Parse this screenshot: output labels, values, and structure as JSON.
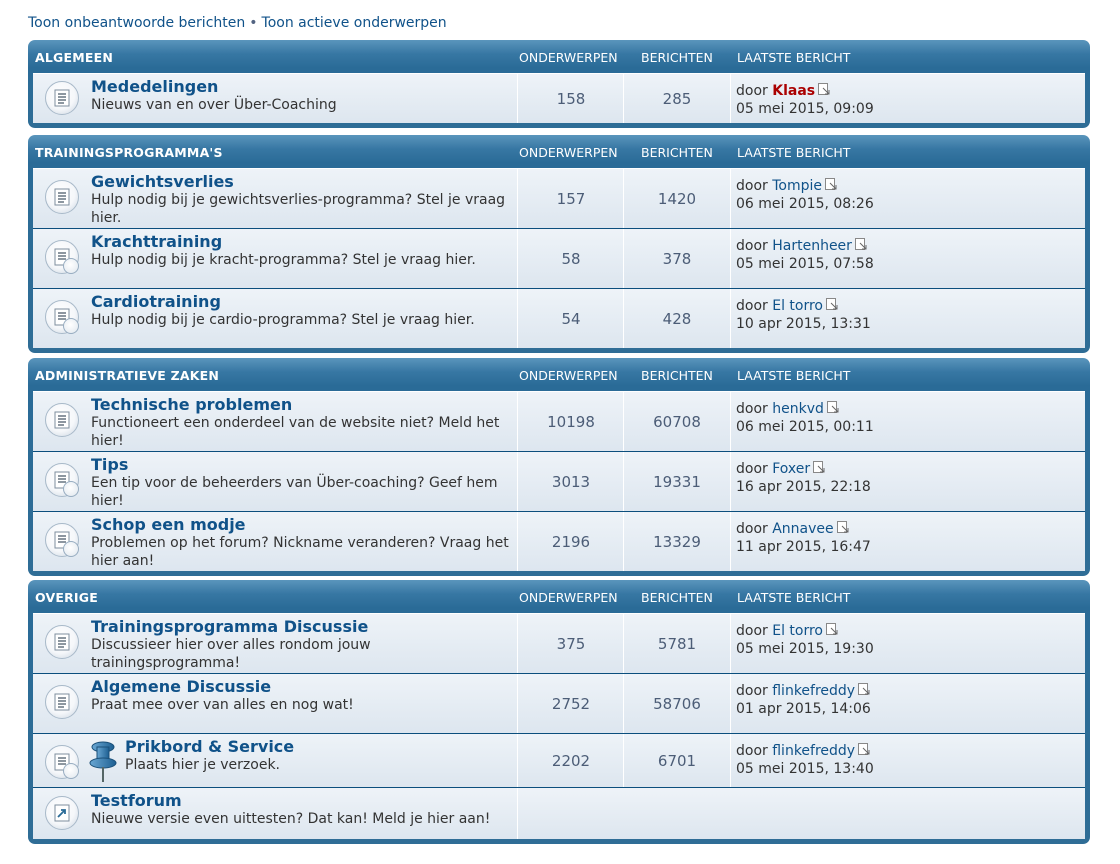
{
  "top_links": {
    "unanswered": "Toon onbeantwoorde berichten",
    "separator": "•",
    "active": "Toon actieve onderwerpen"
  },
  "col_headers": {
    "topics": "ONDERWERPEN",
    "posts": "BERICHTEN",
    "last_post": "LAATSTE BERICHT"
  },
  "by_label": "door",
  "categories": [
    {
      "title": "ALGEMEEN",
      "forums": [
        {
          "title": "Mededelingen",
          "desc": "Nieuws van en over Über-Coaching",
          "topics": "158",
          "posts": "285",
          "author": "Klaas",
          "author_color": "#aa0000",
          "date": "05 mei 2015, 09:09",
          "icon": "forum-read-icon"
        }
      ]
    },
    {
      "title": "TRAININGSPROGRAMMA'S",
      "forums": [
        {
          "title": "Gewichtsverlies",
          "desc": "Hulp nodig bij je gewichtsverlies-programma? Stel je vraag hier.",
          "topics": "157",
          "posts": "1420",
          "author": "Tompie",
          "date": "06 mei 2015, 08:26",
          "icon": "forum-read-icon"
        },
        {
          "title": "Krachttraining",
          "desc": "Hulp nodig bij je kracht-programma? Stel je vraag hier.",
          "topics": "58",
          "posts": "378",
          "author": "Hartenheer",
          "date": "05 mei 2015, 07:58",
          "icon": "forum-subforum-icon"
        },
        {
          "title": "Cardiotraining",
          "desc": "Hulp nodig bij je cardio-programma? Stel je vraag hier.",
          "topics": "54",
          "posts": "428",
          "author": "El torro",
          "date": "10 apr 2015, 13:31",
          "icon": "forum-subforum-icon"
        }
      ]
    },
    {
      "title": "ADMINISTRATIEVE ZAKEN",
      "forums": [
        {
          "title": "Technische problemen",
          "desc": "Functioneert een onderdeel van de website niet? Meld het hier!",
          "topics": "10198",
          "posts": "60708",
          "author": "henkvd",
          "date": "06 mei 2015, 00:11",
          "icon": "forum-read-icon"
        },
        {
          "title": "Tips",
          "desc": "Een tip voor de beheerders van Über-coaching? Geef hem hier!",
          "topics": "3013",
          "posts": "19331",
          "author": "Foxer",
          "date": "16 apr 2015, 22:18",
          "icon": "forum-subforum-icon"
        },
        {
          "title": "Schop een modje",
          "desc": "Problemen op het forum? Nickname veranderen? Vraag het hier aan!",
          "topics": "2196",
          "posts": "13329",
          "author": "Annavee",
          "date": "11 apr 2015, 16:47",
          "icon": "forum-subforum-icon"
        }
      ]
    },
    {
      "title": "OVERIGE",
      "forums": [
        {
          "title": "Trainingsprogramma Discussie",
          "desc": "Discussieer hier over alles rondom jouw trainingsprogramma!",
          "topics": "375",
          "posts": "5781",
          "author": "El torro",
          "date": "05 mei 2015, 19:30",
          "icon": "forum-read-icon"
        },
        {
          "title": "Algemene Discussie",
          "desc": "Praat mee over van alles en nog wat!",
          "topics": "2752",
          "posts": "58706",
          "author": "flinkefreddy",
          "date": "01 apr 2015, 14:06",
          "icon": "forum-read-icon"
        },
        {
          "title": "Prikbord & Service",
          "desc": "Plaats hier je verzoek.",
          "topics": "2202",
          "posts": "6701",
          "author": "flinkefreddy",
          "date": "05 mei 2015, 13:40",
          "icon": "forum-subforum-icon",
          "extra_icon": "pushpin-icon"
        },
        {
          "title": "Testforum",
          "desc": "Nieuwe versie even uittesten? Dat kan! Meld je hier aan!",
          "icon": "forum-link-icon"
        }
      ]
    }
  ]
}
